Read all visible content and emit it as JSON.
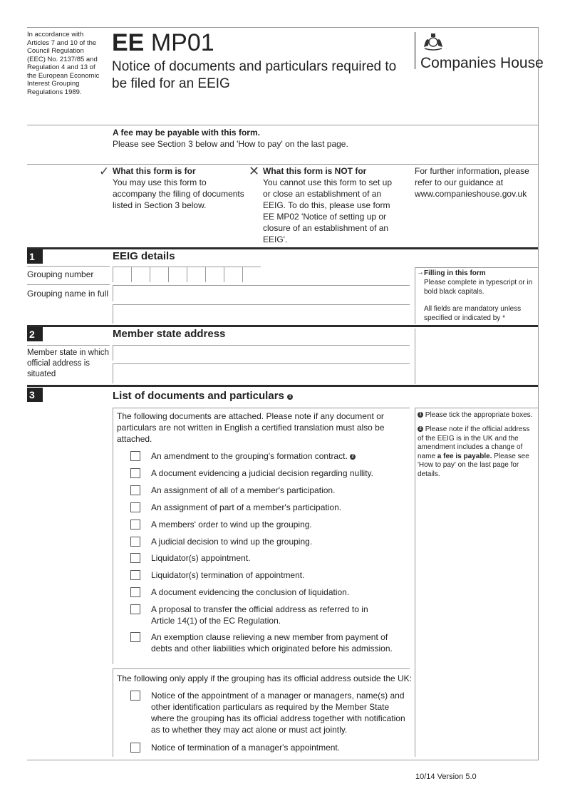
{
  "header": {
    "legal_note": "In accordance with Articles 7 and 10 of the Council Regulation (EEC) No. 2137/85 and Regulation 4 and 13 of the European Economic Interest Grouping Regulations 1989.",
    "form_code_bold": "EE",
    "form_code_rest": "MP01",
    "form_title": "Notice of documents and particulars required to be filed for an EEIG",
    "logo_text": "Companies House",
    "logo_icon": "royal-coat-of-arms-icon"
  },
  "fee_notice": {
    "heading": "A fee may be payable with this form.",
    "text": "Please see Section 3 below and 'How to pay' on the last page."
  },
  "intro": {
    "for_icon": "check-icon",
    "for_title": "What this form is for",
    "for_text": "You may use this form to accompany the filing of documents listed in Section 3 below.",
    "not_for_icon": "cross-icon",
    "not_for_title": "What this form is NOT for",
    "not_for_text": "You cannot use this form to set up or close an establishment of an EEIG. To do this, please use form EE MP02 'Notice of setting up or closure of an establishment of an EEIG'.",
    "further_info": "For further information, please refer to our guidance at www.companieshouse.gov.uk"
  },
  "section1": {
    "number": "1",
    "title": "EEIG details",
    "grouping_number_label": "Grouping number",
    "grouping_number_cells": 8,
    "grouping_name_label": "Grouping name in full",
    "grouping_name_line1": "",
    "grouping_name_line2": "",
    "side_icon": "arrow-right-icon",
    "side_title": "Filling in this form",
    "side_text": "Please complete in typescript or in bold black capitals.",
    "side_text2": "All fields are mandatory unless specified or indicated by *"
  },
  "section2": {
    "number": "2",
    "title": "Member state address",
    "label": "Member state in which official address is situated",
    "line1": "",
    "line2": ""
  },
  "section3": {
    "number": "3",
    "title": "List of documents and particulars",
    "title_note": "1",
    "intro": "The following documents are attached. Please note if any document or particulars are not written in English a certified translation must also be attached.",
    "items": [
      {
        "label": "An amendment to the grouping's formation contract.",
        "note": "2",
        "checked": false
      },
      {
        "label": "A document evidencing a judicial decision regarding nullity.",
        "checked": false
      },
      {
        "label": "An assignment of all of a member's participation.",
        "checked": false
      },
      {
        "label": "An assignment of part of a member's participation.",
        "checked": false
      },
      {
        "label": "A members' order to wind up the grouping.",
        "checked": false
      },
      {
        "label": "A judicial decision to wind up the grouping.",
        "checked": false
      },
      {
        "label": "Liquidator(s) appointment.",
        "checked": false
      },
      {
        "label": "Liquidator(s) termination of appointment.",
        "checked": false
      },
      {
        "label": "A document evidencing the conclusion of liquidation.",
        "checked": false
      },
      {
        "label": "A proposal to transfer the official address as referred to in Article 14(1) of the EC Regulation.",
        "checked": false
      },
      {
        "label": "An exemption clause relieving a new member from payment of debts and other liabilities which originated before his admission.",
        "checked": false
      }
    ],
    "outside_uk_intro": "The following only apply if the grouping has its official address outside the UK:",
    "outside_uk_items": [
      {
        "label": "Notice of the appointment of a manager or managers, name(s) and other identification particulars as required by the Member State where the grouping has its official address together with notification as to whether they may act alone or must act jointly.",
        "checked": false
      },
      {
        "label": "Notice of termination of a manager's appointment.",
        "checked": false
      }
    ],
    "side_note1_num": "1",
    "side_note1": "Please tick the appropriate boxes.",
    "side_note2_num": "2",
    "side_note2_pre": "Please note if the official address of the EEIG is in the UK and the amendment includes a change of name ",
    "side_note2_bold": "a fee is payable.",
    "side_note2_post": " Please see 'How to pay' on the last page for details."
  },
  "footer": {
    "version": "10/14 Version 5.0"
  }
}
